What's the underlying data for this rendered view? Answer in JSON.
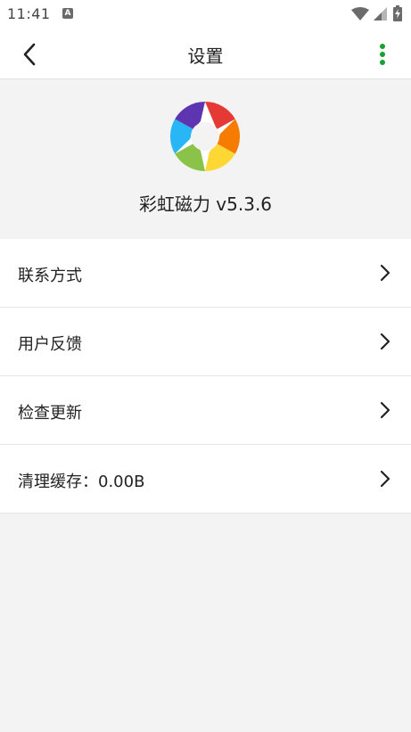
{
  "status_bar": {
    "time": "11:41",
    "notification_icon": "a-icon",
    "wifi_icon": "wifi-icon",
    "signal_icon": "signal-icon",
    "battery_icon": "battery-charging-icon"
  },
  "app_bar": {
    "title": "设置",
    "back_icon": "chevron-left-icon",
    "more_icon": "more-vertical-icon",
    "accent_color": "#1aa034"
  },
  "header": {
    "app_name_version": "彩虹磁力 v5.3.6",
    "logo_icon": "rainbow-aperture-logo"
  },
  "menu": {
    "items": [
      {
        "label": "联系方式"
      },
      {
        "label": "用户反馈"
      },
      {
        "label": "检查更新"
      },
      {
        "label": "清理缓存：0.00B"
      }
    ]
  }
}
